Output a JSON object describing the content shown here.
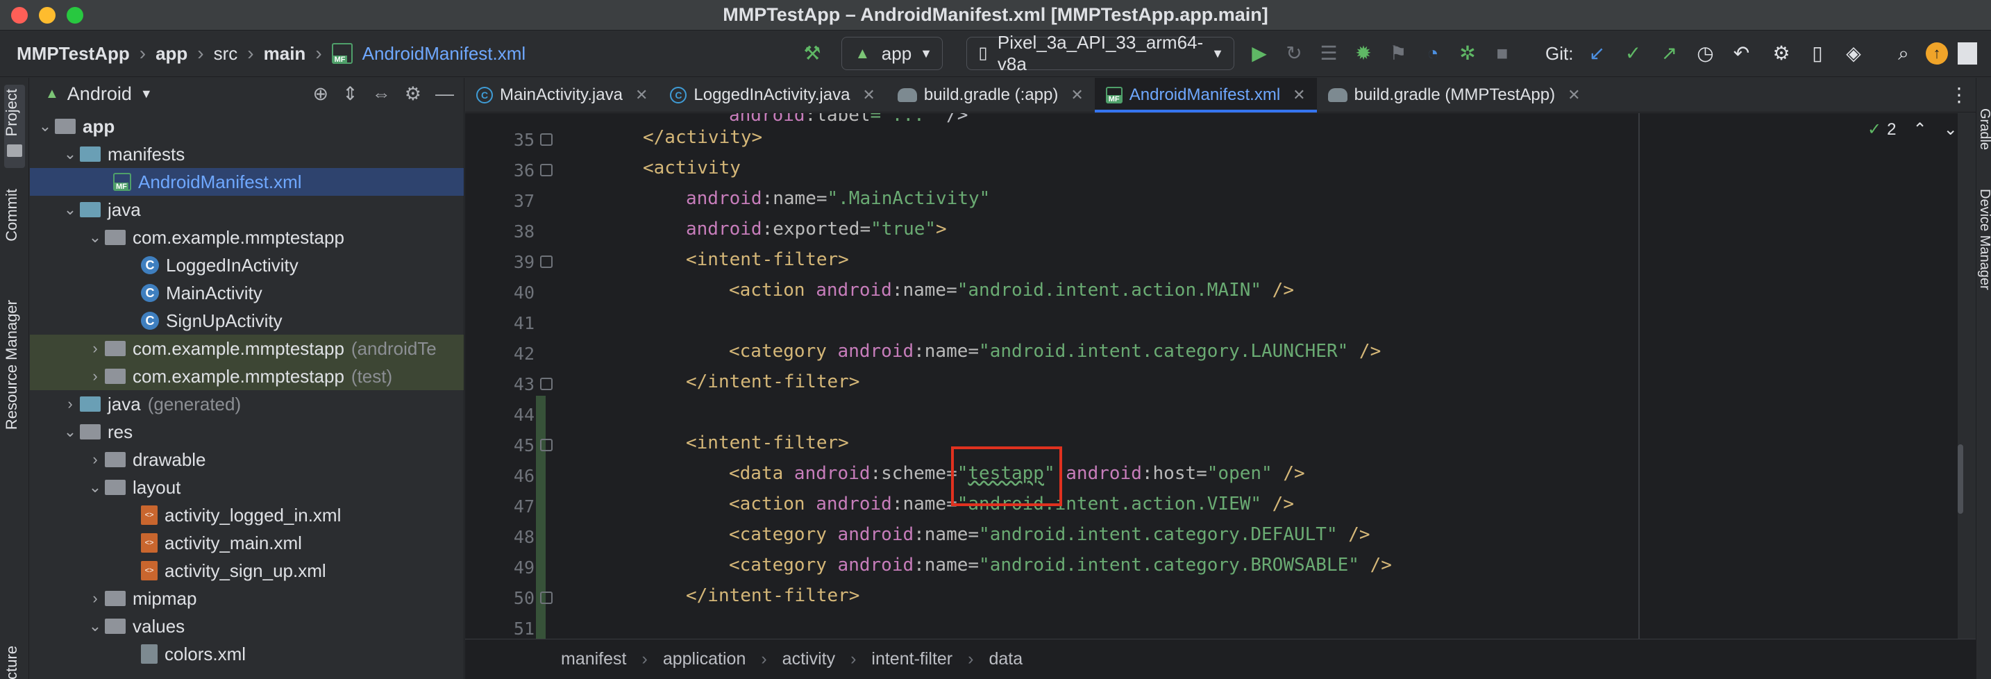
{
  "window": {
    "title": "MMPTestApp – AndroidManifest.xml [MMPTestApp.app.main]"
  },
  "breadcrumb": {
    "items": [
      "MMPTestApp",
      "app",
      "src",
      "main"
    ],
    "file": "AndroidManifest.xml"
  },
  "toolbar": {
    "run_config": "app",
    "device": "Pixel_3a_API_33_arm64-v8a",
    "git_label": "Git:"
  },
  "left_strip": {
    "project": "Project",
    "commit": "Commit",
    "resource_manager": "Resource Manager",
    "structure": "ucture"
  },
  "project_panel": {
    "view": "Android",
    "tree": [
      {
        "label": "app",
        "suffix": ""
      },
      {
        "label": "manifests",
        "suffix": ""
      },
      {
        "label": "AndroidManifest.xml",
        "suffix": ""
      },
      {
        "label": "java",
        "suffix": ""
      },
      {
        "label": "com.example.mmptestapp",
        "suffix": ""
      },
      {
        "label": "LoggedInActivity",
        "suffix": ""
      },
      {
        "label": "MainActivity",
        "suffix": ""
      },
      {
        "label": "SignUpActivity",
        "suffix": ""
      },
      {
        "label": "com.example.mmptestapp",
        "suffix": "(androidTe"
      },
      {
        "label": "com.example.mmptestapp",
        "suffix": "(test)"
      },
      {
        "label": "java",
        "suffix": "(generated)"
      },
      {
        "label": "res",
        "suffix": ""
      },
      {
        "label": "drawable",
        "suffix": ""
      },
      {
        "label": "layout",
        "suffix": ""
      },
      {
        "label": "activity_logged_in.xml",
        "suffix": ""
      },
      {
        "label": "activity_main.xml",
        "suffix": ""
      },
      {
        "label": "activity_sign_up.xml",
        "suffix": ""
      },
      {
        "label": "mipmap",
        "suffix": ""
      },
      {
        "label": "values",
        "suffix": ""
      },
      {
        "label": "colors.xml",
        "suffix": ""
      }
    ]
  },
  "tabs": [
    {
      "label": "MainActivity.java",
      "icon": "class-icon"
    },
    {
      "label": "LoggedInActivity.java",
      "icon": "class-icon"
    },
    {
      "label": "build.gradle (:app)",
      "icon": "gradle-icon"
    },
    {
      "label": "AndroidManifest.xml",
      "icon": "manifest-icon"
    },
    {
      "label": "build.gradle (MMPTestApp)",
      "icon": "gradle-icon"
    }
  ],
  "editor": {
    "line_numbers": [
      "35",
      "36",
      "37",
      "38",
      "39",
      "40",
      "41",
      "42",
      "43",
      "44",
      "45",
      "46",
      "47",
      "48",
      "49",
      "50",
      "51"
    ],
    "inspection_count": "2",
    "highlighted_value": "testapp"
  },
  "bottom_breadcrumb": [
    "manifest",
    "application",
    "activity",
    "intent-filter",
    "data"
  ],
  "right_strip": {
    "gradle": "Gradle",
    "device_manager": "Device Manager"
  },
  "colors": {
    "accent": "#3574f0",
    "highlight_box": "#e0311f",
    "string": "#6aab73",
    "tag": "#d5b778",
    "namespace": "#c77dbb"
  }
}
